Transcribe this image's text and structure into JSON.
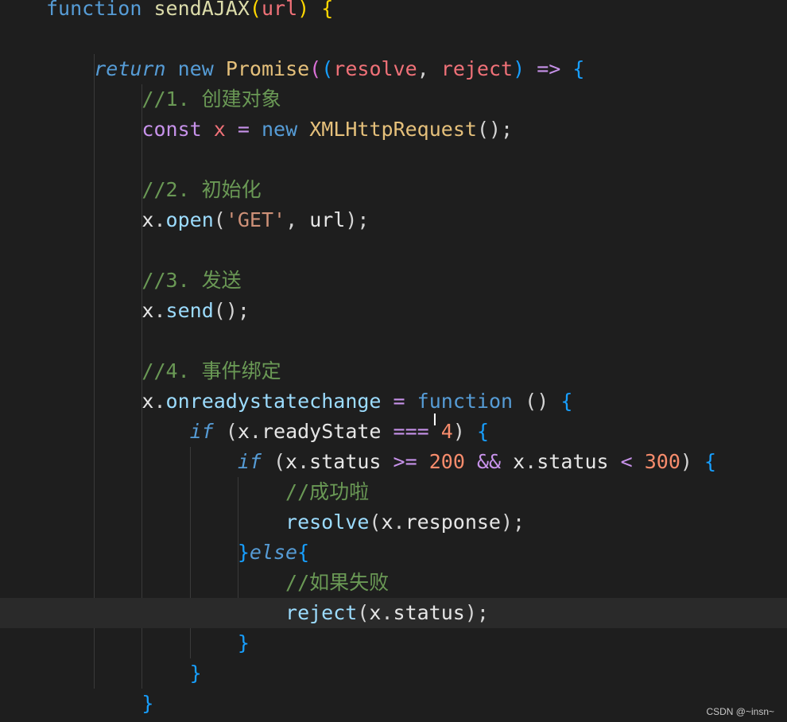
{
  "lines": [
    [
      {
        "t": "function",
        "c": "keyword"
      },
      {
        "t": " ",
        "c": "plain"
      },
      {
        "t": "sendAJAX",
        "c": "function"
      },
      {
        "t": "(",
        "c": "bracket1"
      },
      {
        "t": "url",
        "c": "param"
      },
      {
        "t": ")",
        "c": "bracket1"
      },
      {
        "t": " ",
        "c": "plain"
      },
      {
        "t": "{",
        "c": "bracket1"
      }
    ],
    [],
    [
      {
        "t": "    ",
        "c": "plain"
      },
      {
        "t": "return",
        "c": "control"
      },
      {
        "t": " ",
        "c": "plain"
      },
      {
        "t": "new",
        "c": "keyword"
      },
      {
        "t": " ",
        "c": "plain"
      },
      {
        "t": "Promise",
        "c": "class"
      },
      {
        "t": "(",
        "c": "bracket2"
      },
      {
        "t": "(",
        "c": "bracket3"
      },
      {
        "t": "resolve",
        "c": "param"
      },
      {
        "t": ", ",
        "c": "punct"
      },
      {
        "t": "reject",
        "c": "param"
      },
      {
        "t": ")",
        "c": "bracket3"
      },
      {
        "t": " ",
        "c": "plain"
      },
      {
        "t": "=>",
        "c": "operator"
      },
      {
        "t": " ",
        "c": "plain"
      },
      {
        "t": "{",
        "c": "bracket3"
      }
    ],
    [
      {
        "t": "        ",
        "c": "plain"
      },
      {
        "t": "//1. 创建对象",
        "c": "comment"
      }
    ],
    [
      {
        "t": "        ",
        "c": "plain"
      },
      {
        "t": "const",
        "c": "operator"
      },
      {
        "t": " ",
        "c": "plain"
      },
      {
        "t": "x",
        "c": "param"
      },
      {
        "t": " ",
        "c": "plain"
      },
      {
        "t": "=",
        "c": "operator"
      },
      {
        "t": " ",
        "c": "plain"
      },
      {
        "t": "new",
        "c": "keyword"
      },
      {
        "t": " ",
        "c": "plain"
      },
      {
        "t": "XMLHttpRequest",
        "c": "class"
      },
      {
        "t": "();",
        "c": "punct"
      }
    ],
    [],
    [
      {
        "t": "        ",
        "c": "plain"
      },
      {
        "t": "//2. 初始化",
        "c": "comment"
      }
    ],
    [
      {
        "t": "        ",
        "c": "plain"
      },
      {
        "t": "x",
        "c": "variable"
      },
      {
        "t": ".",
        "c": "punct"
      },
      {
        "t": "open",
        "c": "property"
      },
      {
        "t": "(",
        "c": "punct"
      },
      {
        "t": "'GET'",
        "c": "string"
      },
      {
        "t": ", ",
        "c": "punct"
      },
      {
        "t": "url",
        "c": "variable"
      },
      {
        "t": ");",
        "c": "punct"
      }
    ],
    [],
    [
      {
        "t": "        ",
        "c": "plain"
      },
      {
        "t": "//3. 发送",
        "c": "comment"
      }
    ],
    [
      {
        "t": "        ",
        "c": "plain"
      },
      {
        "t": "x",
        "c": "variable"
      },
      {
        "t": ".",
        "c": "punct"
      },
      {
        "t": "send",
        "c": "property"
      },
      {
        "t": "();",
        "c": "punct"
      }
    ],
    [],
    [
      {
        "t": "        ",
        "c": "plain"
      },
      {
        "t": "//4. 事件绑定",
        "c": "comment"
      }
    ],
    [
      {
        "t": "        ",
        "c": "plain"
      },
      {
        "t": "x",
        "c": "variable"
      },
      {
        "t": ".",
        "c": "punct"
      },
      {
        "t": "onreadystatechange",
        "c": "property"
      },
      {
        "t": " ",
        "c": "plain"
      },
      {
        "t": "=",
        "c": "operator"
      },
      {
        "t": " ",
        "c": "plain"
      },
      {
        "t": "function",
        "c": "keyword"
      },
      {
        "t": " ",
        "c": "plain"
      },
      {
        "t": "()",
        "c": "punct"
      },
      {
        "t": " ",
        "c": "plain"
      },
      {
        "t": "{",
        "c": "bracket3"
      }
    ],
    [
      {
        "t": "            ",
        "c": "plain"
      },
      {
        "t": "if",
        "c": "control"
      },
      {
        "t": " (",
        "c": "punct"
      },
      {
        "t": "x",
        "c": "variable"
      },
      {
        "t": ".",
        "c": "punct"
      },
      {
        "t": "readyState",
        "c": "variable"
      },
      {
        "t": " ",
        "c": "plain"
      },
      {
        "t": "===",
        "c": "operator"
      },
      {
        "t": " ",
        "c": "plain"
      },
      {
        "t": "4",
        "c": "number"
      },
      {
        "t": ") ",
        "c": "punct"
      },
      {
        "t": "{",
        "c": "bracket3"
      }
    ],
    [
      {
        "t": "                ",
        "c": "plain"
      },
      {
        "t": "if",
        "c": "control"
      },
      {
        "t": " (",
        "c": "punct"
      },
      {
        "t": "x",
        "c": "variable"
      },
      {
        "t": ".",
        "c": "punct"
      },
      {
        "t": "status",
        "c": "variable"
      },
      {
        "t": " ",
        "c": "plain"
      },
      {
        "t": ">=",
        "c": "operator"
      },
      {
        "t": " ",
        "c": "plain"
      },
      {
        "t": "200",
        "c": "number"
      },
      {
        "t": " ",
        "c": "plain"
      },
      {
        "t": "&&",
        "c": "operator"
      },
      {
        "t": " ",
        "c": "plain"
      },
      {
        "t": "x",
        "c": "variable"
      },
      {
        "t": ".",
        "c": "punct"
      },
      {
        "t": "status",
        "c": "variable"
      },
      {
        "t": " ",
        "c": "plain"
      },
      {
        "t": "<",
        "c": "operator"
      },
      {
        "t": " ",
        "c": "plain"
      },
      {
        "t": "300",
        "c": "number"
      },
      {
        "t": ") ",
        "c": "punct"
      },
      {
        "t": "{",
        "c": "bracket3"
      }
    ],
    [
      {
        "t": "                    ",
        "c": "plain"
      },
      {
        "t": "//成功啦",
        "c": "comment"
      }
    ],
    [
      {
        "t": "                    ",
        "c": "plain"
      },
      {
        "t": "resolve",
        "c": "property"
      },
      {
        "t": "(",
        "c": "punct"
      },
      {
        "t": "x",
        "c": "variable"
      },
      {
        "t": ".",
        "c": "punct"
      },
      {
        "t": "response",
        "c": "variable"
      },
      {
        "t": ");",
        "c": "punct"
      }
    ],
    [
      {
        "t": "                ",
        "c": "plain"
      },
      {
        "t": "}",
        "c": "bracket3"
      },
      {
        "t": "else",
        "c": "control"
      },
      {
        "t": "{",
        "c": "bracket3"
      }
    ],
    [
      {
        "t": "                    ",
        "c": "plain"
      },
      {
        "t": "//如果失败",
        "c": "comment"
      }
    ],
    [
      {
        "t": "                    ",
        "c": "plain"
      },
      {
        "t": "reject",
        "c": "property"
      },
      {
        "t": "(",
        "c": "punct"
      },
      {
        "t": "x",
        "c": "variable"
      },
      {
        "t": ".",
        "c": "punct"
      },
      {
        "t": "status",
        "c": "variable"
      },
      {
        "t": ");",
        "c": "punct"
      }
    ],
    [
      {
        "t": "                ",
        "c": "plain"
      },
      {
        "t": "}",
        "c": "bracket3"
      }
    ],
    [
      {
        "t": "            ",
        "c": "plain"
      },
      {
        "t": "}",
        "c": "bracket3"
      }
    ],
    [
      {
        "t": "        ",
        "c": "plain"
      },
      {
        "t": "}",
        "c": "bracket3"
      }
    ]
  ],
  "current_line_index": 20,
  "watermark": "CSDN @~insn~",
  "colors": {
    "background": "#1e1e1e",
    "current_line": "#2a2a2a",
    "indent_guide": "#3a3a3a"
  },
  "cursor_icon": "text-cursor-icon"
}
